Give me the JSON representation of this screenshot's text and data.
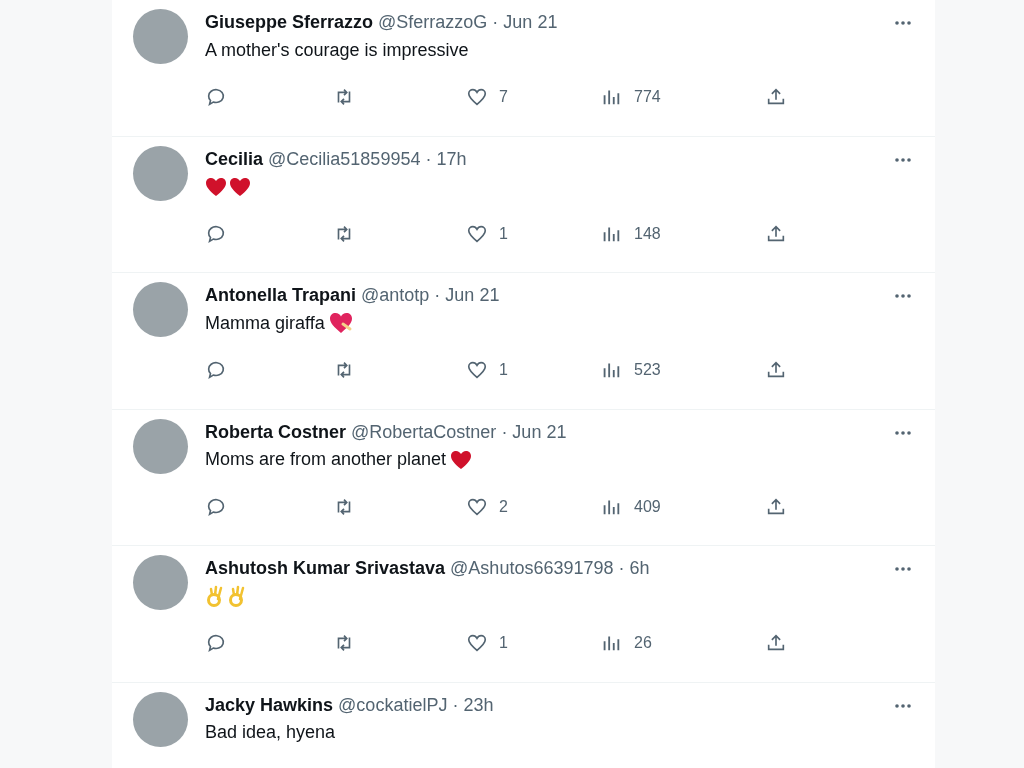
{
  "replies": [
    {
      "name": "Giuseppe Sferrazzo",
      "handle": "@SferrazzoG",
      "time": "· Jun 21",
      "text": "A mother's courage is impressive",
      "actions": {
        "likes": "7",
        "views": "774"
      }
    },
    {
      "name": "Cecilia",
      "handle": "@Cecilia51859954",
      "time": "· 17h",
      "emojis": [
        {
          "kind": "heart"
        },
        {
          "kind": "heart"
        }
      ],
      "actions": {
        "likes": "1",
        "views": "148"
      }
    },
    {
      "name": "Antonella Trapani",
      "handle": "@antotp",
      "time": "· Jun 21",
      "text": "Mamma giraffa",
      "emojis": [
        {
          "kind": "mending_heart"
        }
      ],
      "actions": {
        "likes": "1",
        "views": "523"
      }
    },
    {
      "name": "Roberta Costner",
      "handle": "@RobertaCostner",
      "time": "· Jun 21",
      "text": "Moms are from another planet",
      "emojis": [
        {
          "kind": "heart"
        }
      ],
      "actions": {
        "likes": "2",
        "views": "409"
      }
    },
    {
      "name": "Ashutosh Kumar Srivastava",
      "handle": "@Ashutos66391798",
      "time": "· 6h",
      "emojis": [
        {
          "kind": "ok_hand"
        },
        {
          "kind": "ok_hand"
        }
      ],
      "actions": {
        "likes": "1",
        "views": "26"
      }
    },
    {
      "name": "Jacky Hawkins",
      "handle": "@cockatielPJ",
      "time": "· 23h",
      "text": "Bad idea, hyena"
    }
  ]
}
